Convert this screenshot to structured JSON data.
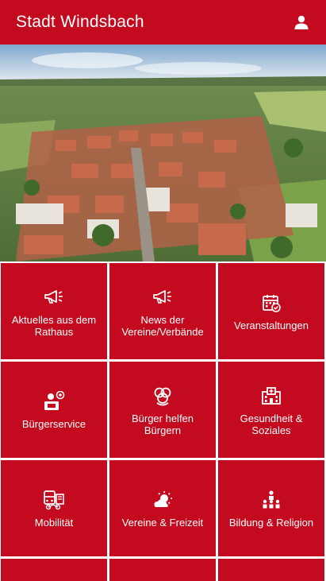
{
  "header": {
    "title": "Stadt Windsbach",
    "profile_icon": "user-icon"
  },
  "hero": {
    "image": "aerial-town-photo"
  },
  "colors": {
    "accent": "#c30a1e",
    "text_on_accent": "#ffffff"
  },
  "tiles": [
    {
      "label": "Aktuelles aus dem Rathaus",
      "icon": "megaphone-icon"
    },
    {
      "label": "News der Vereine/Verbände",
      "icon": "megaphone-icon"
    },
    {
      "label": "Veranstaltungen",
      "icon": "calendar-check-icon"
    },
    {
      "label": "Bürgerservice",
      "icon": "citizen-service-icon"
    },
    {
      "label": "Bürger helfen Bürgern",
      "icon": "helping-hands-icon"
    },
    {
      "label": "Gesundheit & Soziales",
      "icon": "hospital-icon"
    },
    {
      "label": "Mobilität",
      "icon": "mobility-icon"
    },
    {
      "label": "Vereine & Freizeit",
      "icon": "sun-cloud-icon"
    },
    {
      "label": "Bildung & Religion",
      "icon": "education-icon"
    }
  ]
}
